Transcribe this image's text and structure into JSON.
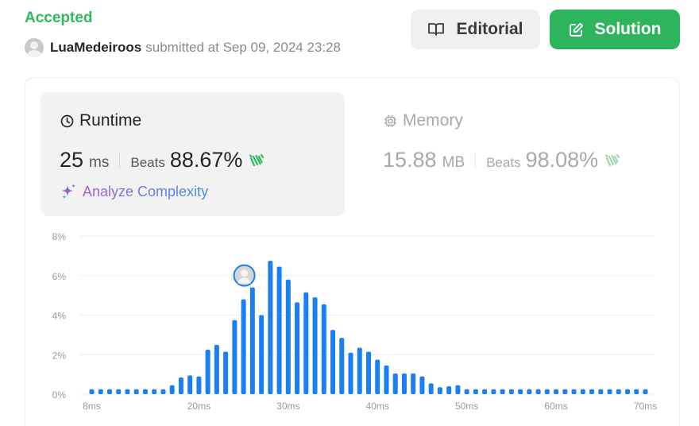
{
  "header": {
    "status": "Accepted",
    "username": "LuaMedeiroos",
    "submitted_text": "submitted at Sep 09, 2024 23:28"
  },
  "buttons": {
    "editorial": "Editorial",
    "solution": "Solution"
  },
  "runtime": {
    "title": "Runtime",
    "value": "25",
    "unit": "ms",
    "beats_label": "Beats",
    "beats_pct": "88.67%",
    "analyze_label": "Analyze Complexity"
  },
  "memory": {
    "title": "Memory",
    "value": "15.88",
    "unit": "MB",
    "beats_label": "Beats",
    "beats_pct": "98.08%"
  },
  "colors": {
    "accent_green": "#2cbb5d",
    "bar_blue": "#1a7ff0",
    "panel_bg": "#f2f2f2"
  },
  "icons": {
    "editorial": "book-open-icon",
    "solution": "edit-icon",
    "runtime": "clock-icon",
    "memory": "chip-icon",
    "beats": "clap-icon",
    "analyze": "sparkle-icon"
  },
  "chart_data": {
    "type": "bar",
    "title": "",
    "xlabel": "",
    "ylabel": "",
    "ylim": [
      0,
      8
    ],
    "yticks": [
      "0%",
      "2%",
      "4%",
      "6%",
      "8%"
    ],
    "xticks": [
      "8ms",
      "20ms",
      "30ms",
      "40ms",
      "50ms",
      "60ms",
      "70ms"
    ],
    "xtick_values": [
      8,
      20,
      30,
      40,
      50,
      60,
      70
    ],
    "xlim": [
      8,
      70
    ],
    "x": [
      8,
      9,
      10,
      11,
      12,
      13,
      14,
      15,
      16,
      17,
      18,
      19,
      20,
      21,
      22,
      23,
      24,
      25,
      26,
      27,
      28,
      29,
      30,
      31,
      32,
      33,
      34,
      35,
      36,
      37,
      38,
      39,
      40,
      41,
      42,
      43,
      44,
      45,
      46,
      47,
      48,
      49,
      50,
      51,
      52,
      53,
      54,
      55,
      56,
      57,
      58,
      59,
      60,
      61,
      62,
      63,
      64,
      65,
      66,
      67,
      68,
      69,
      70
    ],
    "values": [
      0.25,
      0.25,
      0.25,
      0.25,
      0.25,
      0.25,
      0.25,
      0.25,
      0.25,
      0.45,
      0.85,
      0.95,
      0.9,
      2.25,
      2.5,
      2.15,
      3.75,
      4.8,
      5.4,
      4.0,
      6.75,
      6.45,
      5.8,
      4.65,
      5.15,
      4.9,
      4.55,
      3.25,
      2.85,
      2.1,
      2.35,
      2.15,
      1.75,
      1.45,
      1.05,
      1.05,
      1.05,
      0.9,
      0.55,
      0.35,
      0.4,
      0.45,
      0.25,
      0.25,
      0.25,
      0.25,
      0.25,
      0.25,
      0.25,
      0.25,
      0.25,
      0.25,
      0.25,
      0.25,
      0.25,
      0.25,
      0.25,
      0.25,
      0.25,
      0.25,
      0.25,
      0.25,
      0.25
    ],
    "highlight_x": 25,
    "grid": true,
    "legend": "none"
  }
}
